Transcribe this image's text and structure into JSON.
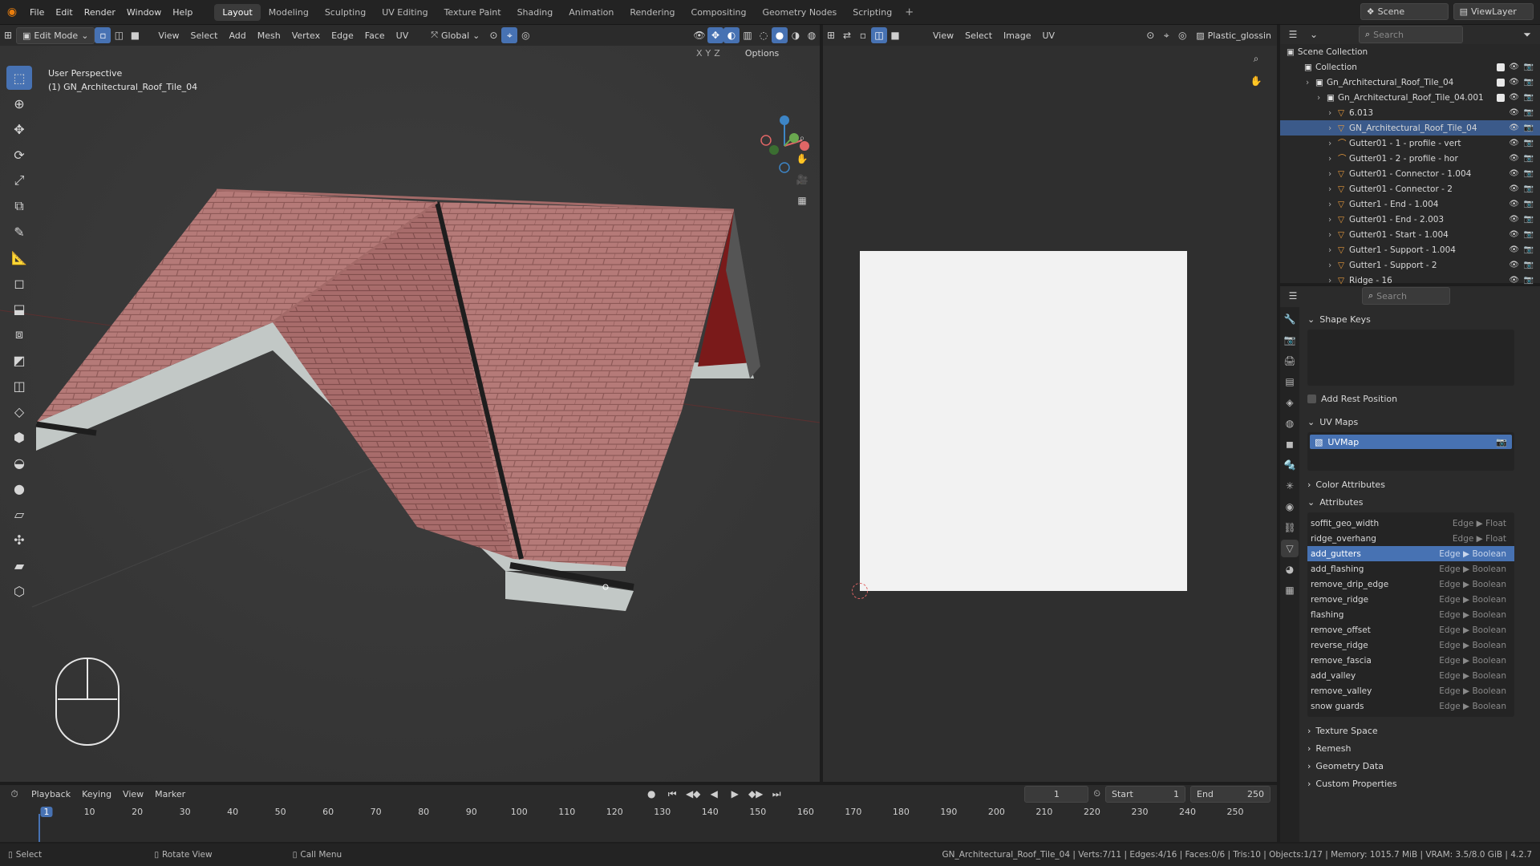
{
  "menu": [
    "File",
    "Edit",
    "Render",
    "Window",
    "Help"
  ],
  "workspaces": [
    "Layout",
    "Modeling",
    "Sculpting",
    "UV Editing",
    "Texture Paint",
    "Shading",
    "Animation",
    "Rendering",
    "Compositing",
    "Geometry Nodes",
    "Scripting"
  ],
  "active_workspace": "Layout",
  "scene": {
    "label": "Scene",
    "view_layer": "ViewLayer",
    "search_placeholder": "Search"
  },
  "viewport_header": {
    "mode": "Edit Mode",
    "items": [
      "View",
      "Select",
      "Add",
      "Mesh",
      "Vertex",
      "Edge",
      "Face",
      "UV"
    ],
    "orientation": "Global",
    "options": "Options",
    "axes": [
      "X",
      "Y",
      "Z"
    ]
  },
  "viewport": {
    "perspective": "User Perspective",
    "object": "(1) GN_Architectural_Roof_Tile_04"
  },
  "uv_header": {
    "items": [
      "View",
      "Select",
      "Image",
      "UV"
    ],
    "material": "Plastic_glossin"
  },
  "outliner": {
    "root": "Scene Collection",
    "rows": [
      {
        "label": "Collection",
        "indent": 0
      },
      {
        "label": "Gn_Architectural_Roof_Tile_04",
        "indent": 1
      },
      {
        "label": "Gn_Architectural_Roof_Tile_04.001",
        "indent": 2
      },
      {
        "label": "6.013",
        "indent": 3
      },
      {
        "label": "GN_Architectural_Roof_Tile_04",
        "indent": 3
      },
      {
        "label": "Gutter01 - 1 - profile - vert",
        "indent": 3
      },
      {
        "label": "Gutter01 - 2 - profile - hor",
        "indent": 3
      },
      {
        "label": "Gutter01 - Connector - 1.004",
        "indent": 3
      },
      {
        "label": "Gutter01 - Connector - 2",
        "indent": 3
      },
      {
        "label": "Gutter1 - End - 1.004",
        "indent": 3
      },
      {
        "label": "Gutter01 - End - 2.003",
        "indent": 3
      },
      {
        "label": "Gutter01 - Start - 1.004",
        "indent": 3
      },
      {
        "label": "Gutter1 - Support - 1.004",
        "indent": 3
      },
      {
        "label": "Gutter1 - Support - 2",
        "indent": 3
      },
      {
        "label": "Ridge - 16",
        "indent": 3
      }
    ]
  },
  "props": {
    "search_placeholder": "Search",
    "shape_keys": "Shape Keys",
    "add_rest_position": "Add Rest Position",
    "uv_maps": "UV Maps",
    "uvmap": "UVMap",
    "color_attributes": "Color Attributes",
    "attributes": "Attributes",
    "attribute_rows": [
      {
        "name": "soffit_geo_width",
        "type": "Edge ▶ Float"
      },
      {
        "name": "ridge_overhang",
        "type": "Edge ▶ Float"
      },
      {
        "name": "add_gutters",
        "type": "Edge ▶ Boolean"
      },
      {
        "name": "add_flashing",
        "type": "Edge ▶ Boolean"
      },
      {
        "name": "remove_drip_edge",
        "type": "Edge ▶ Boolean"
      },
      {
        "name": "remove_ridge",
        "type": "Edge ▶ Boolean"
      },
      {
        "name": "flashing",
        "type": "Edge ▶ Boolean"
      },
      {
        "name": "remove_offset",
        "type": "Edge ▶ Boolean"
      },
      {
        "name": "reverse_ridge",
        "type": "Edge ▶ Boolean"
      },
      {
        "name": "remove_fascia",
        "type": "Edge ▶ Boolean"
      },
      {
        "name": "add_valley",
        "type": "Edge ▶ Boolean"
      },
      {
        "name": "remove_valley",
        "type": "Edge ▶ Boolean"
      },
      {
        "name": "snow guards",
        "type": "Edge ▶ Boolean"
      }
    ],
    "texture_space": "Texture Space",
    "remesh": "Remesh",
    "geometry_data": "Geometry Data",
    "custom_properties": "Custom Properties"
  },
  "timeline": {
    "items": [
      "Playback",
      "Keying",
      "View",
      "Marker"
    ],
    "current": "1",
    "start_label": "Start",
    "start": "1",
    "end_label": "End",
    "end": "250",
    "ticks": [
      "1",
      "10",
      "20",
      "30",
      "40",
      "50",
      "60",
      "70",
      "80",
      "90",
      "100",
      "110",
      "120",
      "130",
      "140",
      "150",
      "160",
      "170",
      "180",
      "190",
      "200",
      "210",
      "220",
      "230",
      "240",
      "250"
    ]
  },
  "status": {
    "select": "Select",
    "rotate": "Rotate View",
    "call_menu": "Call Menu",
    "info": "GN_Architectural_Roof_Tile_04 | Verts:7/11 | Edges:4/16 | Faces:0/6 | Tris:10 | Objects:1/17 | Memory: 1015.7 MiB | VRAM: 3.5/8.0 GiB | 4.2.7"
  },
  "colors": {
    "accent": "#4772b3",
    "roof": "#b57a78",
    "wall": "#c2c8c6",
    "gutter": "#1e1e1e"
  }
}
